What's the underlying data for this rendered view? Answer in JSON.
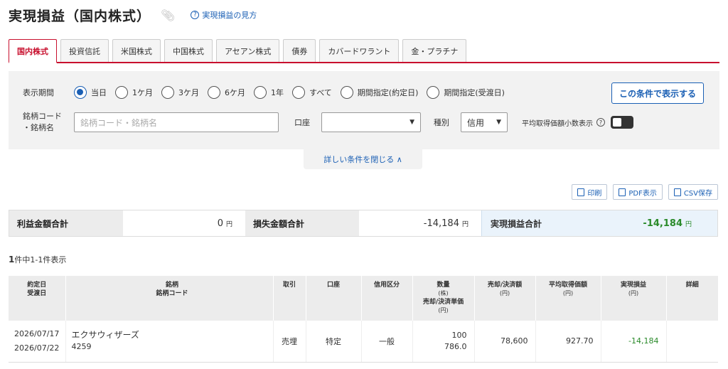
{
  "header": {
    "title": "実現損益（国内株式）",
    "help_link": "実現損益の見方"
  },
  "tabs": [
    {
      "label": "国内株式",
      "active": true
    },
    {
      "label": "投資信託"
    },
    {
      "label": "米国株式"
    },
    {
      "label": "中国株式"
    },
    {
      "label": "アセアン株式"
    },
    {
      "label": "債券"
    },
    {
      "label": "カバードワラント"
    },
    {
      "label": "金・プラチナ"
    }
  ],
  "filter": {
    "period_label": "表示期間",
    "periods": [
      "当日",
      "1ケ月",
      "3ケ月",
      "6ケ月",
      "1年",
      "すべて",
      "期間指定(約定日)",
      "期間指定(受渡日)"
    ],
    "selected_period": "当日",
    "submit_label": "この条件で表示する",
    "stock_label_line1": "銘柄コード",
    "stock_label_line2": "・銘柄名",
    "stock_placeholder": "銘柄コード・銘柄名",
    "account_label": "口座",
    "account_value": "",
    "kind_label": "種別",
    "kind_value": "信用",
    "decimal_label": "平均取得価額小数表示",
    "decimal_on": false,
    "collapse_label": "詳しい条件を閉じる"
  },
  "actions": {
    "print": "印刷",
    "pdf": "PDF表示",
    "csv": "CSV保存"
  },
  "summary": {
    "profit_label": "利益金額合計",
    "profit_value": "0",
    "loss_label": "損失金額合計",
    "loss_value": "-14,184",
    "total_label": "実現損益合計",
    "total_value": "-14,184",
    "yen": "円"
  },
  "count": {
    "total": "1",
    "text": "件中1-1件表示"
  },
  "table": {
    "headers": {
      "date1": "約定日",
      "date2": "受渡日",
      "name1": "銘柄",
      "name2": "銘柄コード",
      "trade": "取引",
      "account": "口座",
      "credit": "信用区分",
      "qty": "数量",
      "qty_unit": "(株)",
      "qty2": "売却/決済単価",
      "qty2_unit": "(円)",
      "amount": "売却/決済額",
      "amount_unit": "(円)",
      "avg": "平均取得価額",
      "avg_unit": "(円)",
      "pnl": "実現損益",
      "pnl_unit": "(円)",
      "detail": "詳細"
    },
    "rows": [
      {
        "trade_date": "2026/07/17",
        "settle_date": "2026/07/22",
        "name": "エクサウィザーズ",
        "code": "4259",
        "trade": "売埋",
        "account": "特定",
        "credit": "一般",
        "qty": "100",
        "price": "786.0",
        "amount": "78,600",
        "avg": "927.70",
        "pnl": "-14,184"
      }
    ]
  },
  "colors": {
    "accent": "#c8102e",
    "link": "#1a5fb4",
    "negative": "#2a8a2a"
  }
}
